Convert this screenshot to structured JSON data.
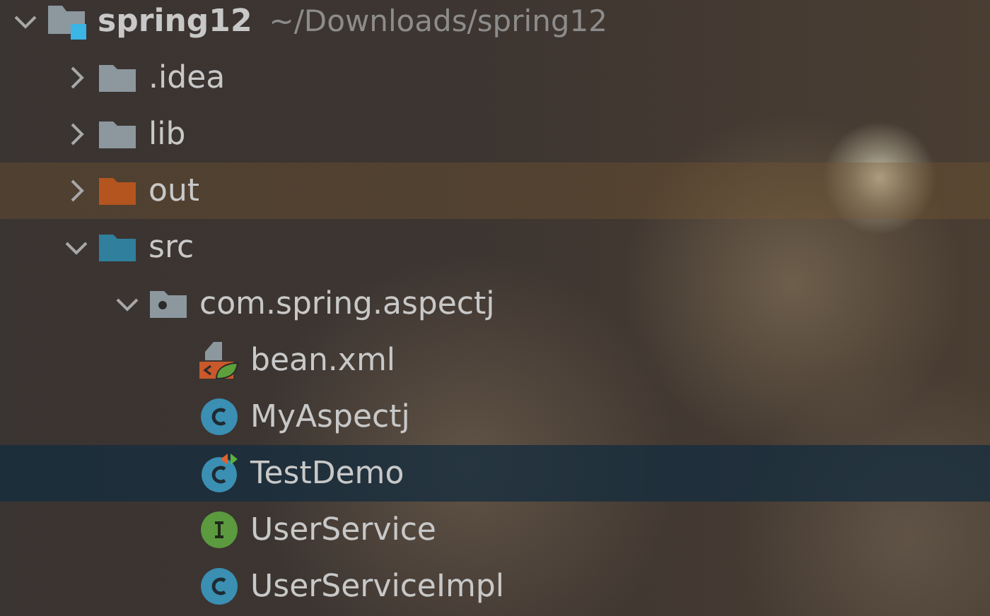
{
  "project_tree": [
    {
      "label": "spring12",
      "path": "~/Downloads/spring12",
      "kind": "module",
      "expanded": true,
      "selected": false,
      "excluded": false,
      "children": [
        {
          "label": ".idea",
          "kind": "folder",
          "expanded": false,
          "selected": false,
          "excluded": false
        },
        {
          "label": "lib",
          "kind": "folder",
          "expanded": false,
          "selected": false,
          "excluded": false
        },
        {
          "label": "out",
          "kind": "excluded-folder",
          "expanded": false,
          "selected": false,
          "excluded": true
        },
        {
          "label": "src",
          "kind": "source-folder",
          "expanded": true,
          "selected": false,
          "excluded": false,
          "children": [
            {
              "label": "com.spring.aspectj",
              "kind": "package",
              "expanded": true,
              "selected": false,
              "excluded": false,
              "children": [
                {
                  "label": "bean.xml",
                  "kind": "spring-xml",
                  "selected": false,
                  "excluded": false
                },
                {
                  "label": "MyAspectj",
                  "kind": "class",
                  "selected": false,
                  "excluded": false
                },
                {
                  "label": "TestDemo",
                  "kind": "runnable-class",
                  "selected": true,
                  "excluded": false
                },
                {
                  "label": "UserService",
                  "kind": "interface",
                  "selected": false,
                  "excluded": false
                },
                {
                  "label": "UserServiceImpl",
                  "kind": "class",
                  "selected": false,
                  "excluded": false
                }
              ]
            }
          ]
        }
      ]
    }
  ]
}
